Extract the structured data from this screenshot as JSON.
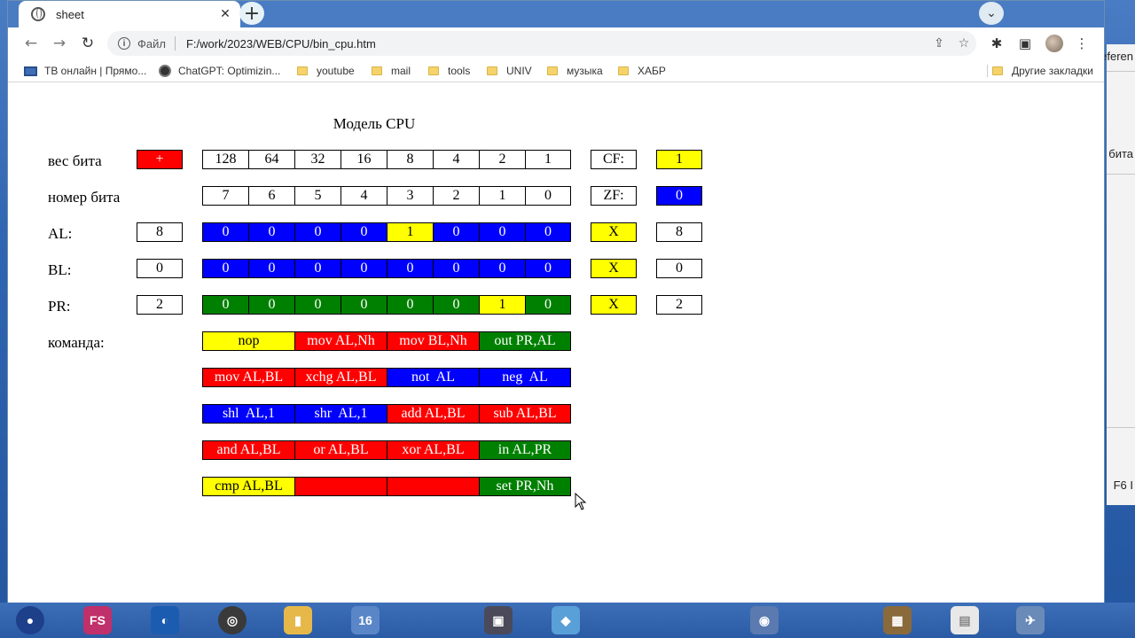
{
  "desktop": {
    "right_panel_texts": [
      "eferen",
      "бита",
      "F6 I"
    ]
  },
  "browser": {
    "tab": {
      "title": "sheet",
      "close": "✕"
    },
    "newtab": "+",
    "toolbar": {
      "back": "←",
      "forward": "→",
      "reload": "↻",
      "scheme": "Файл",
      "url": "F:/work/2023/WEB/CPU/bin_cpu.htm",
      "share": "⇪",
      "star": "☆",
      "extensions": "✱",
      "sidepanel": "▣",
      "menu": "⋮"
    },
    "bookmarks": [
      {
        "label": "ТВ онлайн | Прямо...",
        "icon": "monitor-icon"
      },
      {
        "label": "ChatGPT: Optimizin...",
        "icon": "chatgpt-icon"
      },
      {
        "label": "youtube",
        "icon": "folder-icon"
      },
      {
        "label": "mail",
        "icon": "folder-icon"
      },
      {
        "label": "tools",
        "icon": "folder-icon"
      },
      {
        "label": "UNIV",
        "icon": "folder-icon"
      },
      {
        "label": "музыка",
        "icon": "folder-icon"
      },
      {
        "label": "ХАБР",
        "icon": "folder-icon"
      }
    ],
    "other_bookmarks": "Другие закладки"
  },
  "page": {
    "title": "Модель CPU",
    "labels": {
      "weight": "вес бита",
      "bitnum": "номер бита",
      "al": "AL:",
      "bl": "BL:",
      "pr": "PR:",
      "command": "команда:"
    },
    "sign_button": "+",
    "weights": [
      "128",
      "64",
      "32",
      "16",
      "8",
      "4",
      "2",
      "1"
    ],
    "bit_numbers": [
      "7",
      "6",
      "5",
      "4",
      "3",
      "2",
      "1",
      "0"
    ],
    "flags": {
      "cf_label": "CF:",
      "cf_value": "1",
      "zf_label": "ZF:",
      "zf_value": "0"
    },
    "registers": {
      "al": {
        "decimal": "8",
        "bits": [
          "0",
          "0",
          "0",
          "0",
          "1",
          "0",
          "0",
          "0"
        ],
        "x": "X",
        "result": "8"
      },
      "bl": {
        "decimal": "0",
        "bits": [
          "0",
          "0",
          "0",
          "0",
          "0",
          "0",
          "0",
          "0"
        ],
        "x": "X",
        "result": "0"
      },
      "pr": {
        "decimal": "2",
        "bits": [
          "0",
          "0",
          "0",
          "0",
          "0",
          "0",
          "1",
          "0"
        ],
        "x": "X",
        "result": "2"
      }
    },
    "commands": [
      [
        "nop",
        "mov AL,Nh",
        "mov BL,Nh",
        "out PR,AL"
      ],
      [
        "mov AL,BL",
        "xchg AL,BL",
        "not  AL",
        "neg  AL"
      ],
      [
        "shl  AL,1",
        "shr  AL,1",
        "add AL,BL",
        "sub AL,BL"
      ],
      [
        "and AL,BL",
        "or AL,BL",
        "xor AL,BL",
        "in AL,PR"
      ],
      [
        "cmp AL,BL",
        "",
        "",
        "set PR,Nh"
      ]
    ],
    "colors": {
      "red": "#ff0000",
      "blue": "#0000ff",
      "green": "#008000",
      "yellow": "#ffff00"
    }
  }
}
